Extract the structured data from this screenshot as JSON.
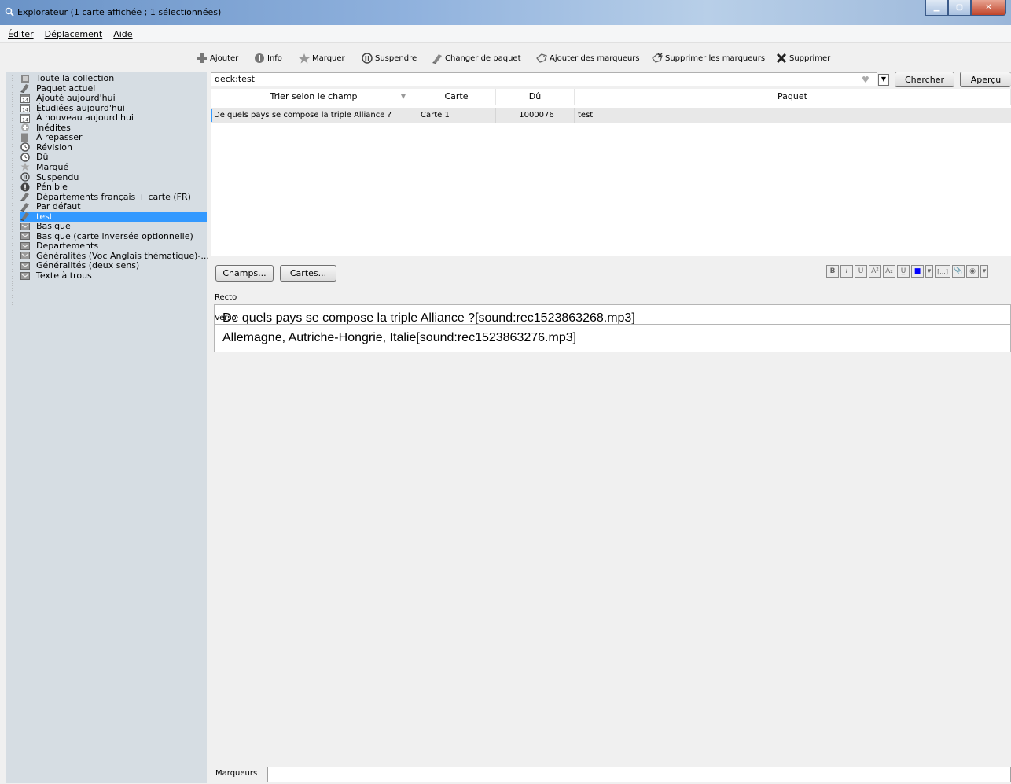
{
  "window": {
    "title": "Explorateur (1 carte affichée ; 1 sélectionnées)"
  },
  "menu": [
    "Éditer",
    "Déplacement",
    "Aide"
  ],
  "toolbar": [
    "Ajouter",
    "Info",
    "Marquer",
    "Suspendre",
    "Changer de paquet",
    "Ajouter des marqueurs",
    "Supprimer les marqueurs",
    "Supprimer"
  ],
  "sidebar": [
    {
      "label": "Toute la collection",
      "icon": "collection-icon"
    },
    {
      "label": "Paquet actuel",
      "icon": "deck-icon"
    },
    {
      "label": "Ajouté aujourd'hui",
      "icon": "calendar-icon"
    },
    {
      "label": "Étudiées aujourd'hui",
      "icon": "calendar-icon"
    },
    {
      "label": "À nouveau aujourd'hui",
      "icon": "calendar-icon"
    },
    {
      "label": "Inédites",
      "icon": "plus-circle-icon"
    },
    {
      "label": "À repasser",
      "icon": "card-icon"
    },
    {
      "label": "Révision",
      "icon": "clock-icon"
    },
    {
      "label": "Dû",
      "icon": "clock-icon"
    },
    {
      "label": "Marqué",
      "icon": "star-icon"
    },
    {
      "label": "Suspendu",
      "icon": "pause-icon"
    },
    {
      "label": "Pénible",
      "icon": "warning-icon"
    },
    {
      "label": "Départements français + carte (FR)",
      "icon": "deck-icon"
    },
    {
      "label": "Par défaut",
      "icon": "deck-icon"
    },
    {
      "label": "test",
      "icon": "deck-icon",
      "selected": true
    },
    {
      "label": "Basique",
      "icon": "notetype-icon"
    },
    {
      "label": "Basique (carte inversée optionnelle)",
      "icon": "notetype-icon"
    },
    {
      "label": "Departements",
      "icon": "notetype-icon"
    },
    {
      "label": "Généralités (Voc Anglais thématique)-...",
      "icon": "notetype-icon"
    },
    {
      "label": "Généralités (deux sens)",
      "icon": "notetype-icon"
    },
    {
      "label": "Texte à trous",
      "icon": "notetype-icon"
    }
  ],
  "search": {
    "value": "deck:test",
    "search_button": "Chercher",
    "preview_button": "Aperçu"
  },
  "table": {
    "columns": [
      "Trier selon le champ",
      "Carte",
      "Dû",
      "Paquet"
    ],
    "rows": [
      [
        "De quels pays se compose la triple Alliance ?",
        "Carte 1",
        "1000076",
        "test"
      ]
    ]
  },
  "editor": {
    "fields_button": "Champs...",
    "cards_button": "Cartes...",
    "format_buttons": [
      "B",
      "I",
      "U",
      "A²",
      "A₂",
      "U̲",
      "■",
      "▾",
      "[...]",
      "📎",
      "◉",
      "▾"
    ],
    "front_label": "Recto",
    "front_value": "De quels pays se compose la triple Alliance ?[sound:rec1523863268.mp3]",
    "back_label": "Verso",
    "back_value": "Allemagne, Autriche-Hongrie, Italie[sound:rec1523863276.mp3]",
    "tags_label": "Marqueurs",
    "tags_value": ""
  }
}
